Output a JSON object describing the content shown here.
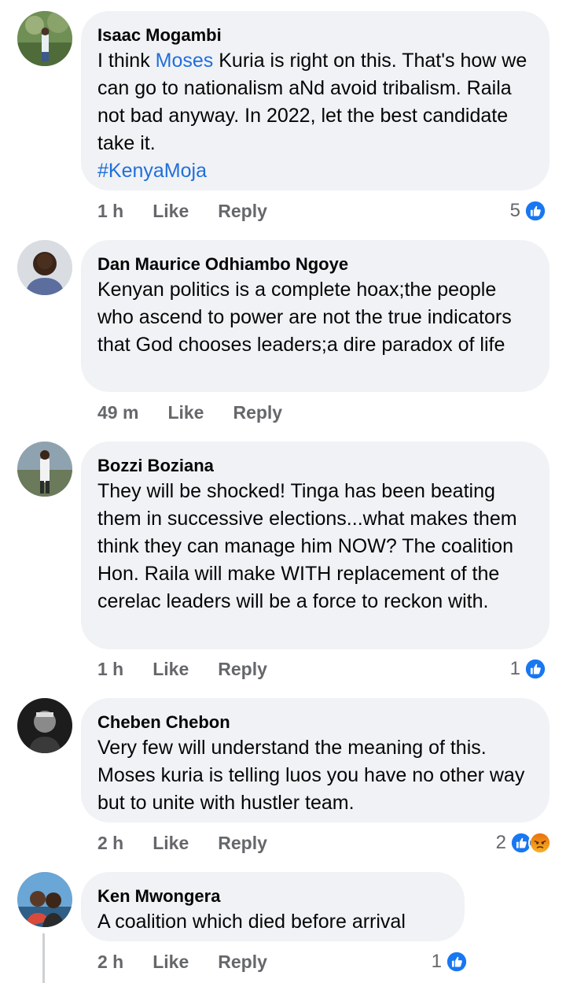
{
  "comments": [
    {
      "author": "Isaac Mogambi",
      "text_prefix": "I think ",
      "mention": "Moses",
      "text_suffix": " Kuria is right on this. That's how we can go to nationalism aNd avoid tribalism. Raila not bad anyway. In 2022, let the best candidate take it.",
      "hashtag": "#KenyaMoja",
      "time": "1 h",
      "like_label": "Like",
      "reply_label": "Reply",
      "reaction_count": "5",
      "reactions": [
        "like-icon"
      ]
    },
    {
      "author": "Dan Maurice Odhiambo Ngoye",
      "text": "Kenyan politics is a complete hoax;the people who ascend to power are not the true indicators that God chooses leaders;a dire paradox of life",
      "time": "49 m",
      "like_label": "Like",
      "reply_label": "Reply"
    },
    {
      "author": "Bozzi Boziana",
      "text": "They will be shocked! Tinga has been beating them in successive elections...what makes them think they can manage him NOW? The coalition Hon. Raila will make WITH replacement of the cerelac leaders will be a force to reckon with.",
      "time": "1 h",
      "like_label": "Like",
      "reply_label": "Reply",
      "reaction_count": "1",
      "reactions": [
        "like-icon"
      ]
    },
    {
      "author": "Cheben Chebon",
      "text": "Very few will understand the meaning of this. Moses kuria is telling luos you have no other way but to unite with hustler team.",
      "time": "2 h",
      "like_label": "Like",
      "reply_label": "Reply",
      "reaction_count": "2",
      "reactions": [
        "like-icon",
        "angry-icon"
      ]
    },
    {
      "author": "Ken Mwongera",
      "text": "A coalition which died before arrival",
      "time": "2 h",
      "like_label": "Like",
      "reply_label": "Reply",
      "reaction_count": "1",
      "reactions": [
        "like-icon"
      ]
    }
  ],
  "colors": {
    "bubble": "#f0f2f5",
    "link": "#216fdb",
    "meta": "#65676b",
    "like_blue": "#1877f2"
  }
}
